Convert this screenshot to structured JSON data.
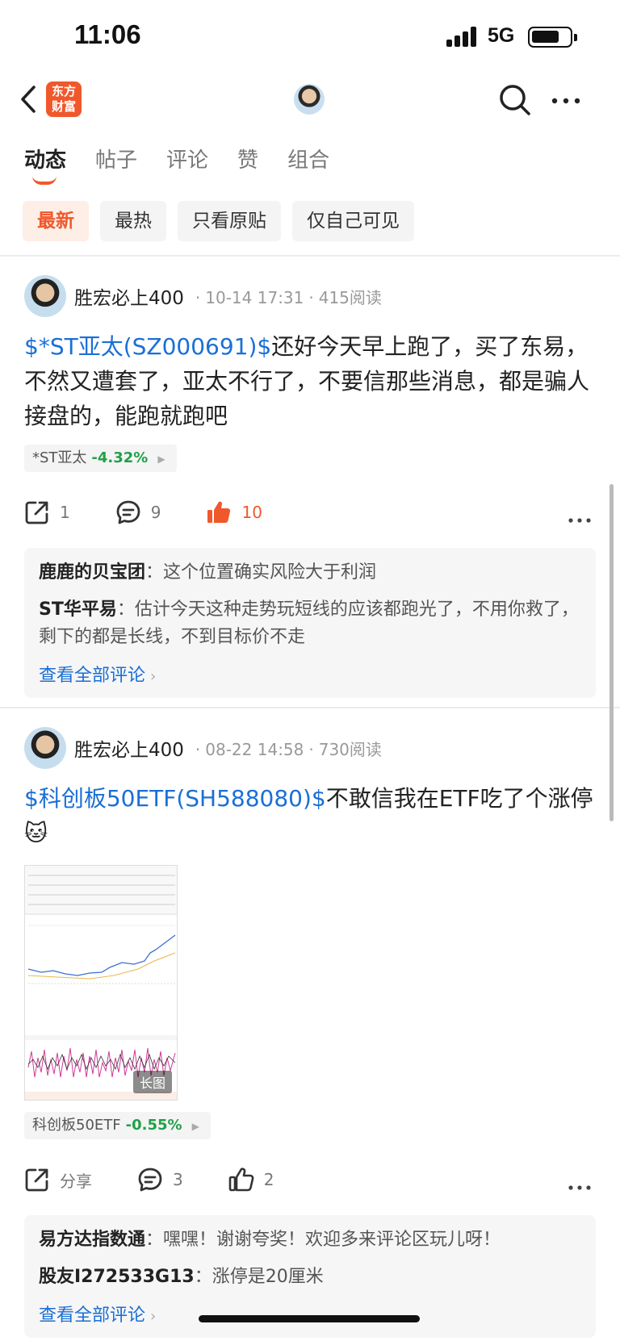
{
  "status_bar": {
    "time": "11:06",
    "network": "5G"
  },
  "nav": {
    "logo_line1": "东方",
    "logo_line2": "财富"
  },
  "tabs": [
    {
      "label": "动态",
      "active": true
    },
    {
      "label": "帖子",
      "active": false
    },
    {
      "label": "评论",
      "active": false
    },
    {
      "label": "赞",
      "active": false
    },
    {
      "label": "组合",
      "active": false
    }
  ],
  "filters": [
    {
      "label": "最新",
      "active": true
    },
    {
      "label": "最热",
      "active": false
    },
    {
      "label": "只看原贴",
      "active": false
    },
    {
      "label": "仅自己可见",
      "active": false
    }
  ],
  "posts": [
    {
      "author": "胜宏必上400",
      "date": "10-14 17:31",
      "reads": "415阅读",
      "tag": "$*ST亚太(SZ000691)$",
      "text": "还好今天早上跑了，买了东易，不然又遭套了，亚太不行了，不要信那些消息，都是骗人接盘的，能跑就跑吧",
      "stock_name": "*ST亚太",
      "stock_change": "-4.32%",
      "share_count": "1",
      "comment_count": "9",
      "like_count": "10",
      "comments": [
        {
          "name": "鹿鹿的贝宝团",
          "text": "这个位置确实风险大于利润"
        },
        {
          "name": "ST华平易",
          "text": "估计今天这种走势玩短线的应该都跑光了，不用你救了，剩下的都是长线，不到目标价不走"
        }
      ],
      "view_all": "查看全部评论"
    },
    {
      "author": "胜宏必上400",
      "date": "08-22 14:58",
      "reads": "730阅读",
      "tag": "$科创板50ETF(SH588080)$",
      "text": "不敢信我在ETF吃了个涨停🐱",
      "image_tag": "长图",
      "stock_name": "科创板50ETF",
      "stock_change": "-0.55%",
      "share_label": "分享",
      "comment_count": "3",
      "like_count": "2",
      "comments": [
        {
          "name": "易方达指数通",
          "text": "嘿嘿！谢谢夸奖！欢迎多来评论区玩儿呀！"
        },
        {
          "name": "股友I272533G13",
          "text": "涨停是20厘米"
        }
      ],
      "view_all": "查看全部评论"
    }
  ],
  "colors": {
    "accent": "#f0582c",
    "link": "#1a6fd6",
    "down": "#21a04a"
  }
}
